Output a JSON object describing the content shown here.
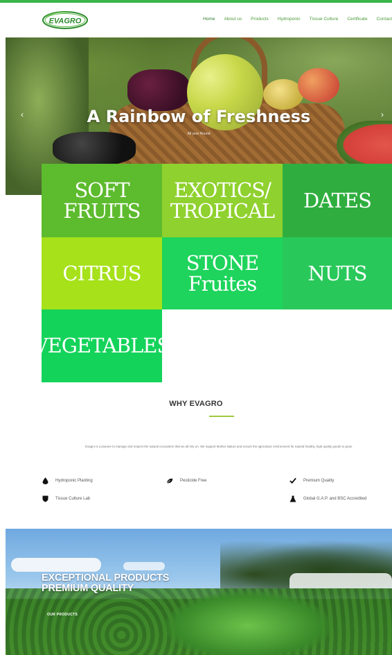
{
  "nav": {
    "items": [
      "Home",
      "About us",
      "Products",
      "Hydroponic",
      "Tissue Culture",
      "Certificate",
      "Contact"
    ],
    "active_index": 0
  },
  "logo": {
    "text": "EVAGRO"
  },
  "hero": {
    "title": "A Rainbow of Freshness",
    "subtitle": "All year Round",
    "prev_glyph": "‹",
    "next_glyph": "›"
  },
  "categories": [
    {
      "label": "SOFT FRUITS",
      "color": "#5dbb2e"
    },
    {
      "label": "EXOTICS/ TROPICAL",
      "color": "#8fd12e"
    },
    {
      "label": "DATES",
      "color": "#2fae3f"
    },
    {
      "label": "CITRUS",
      "color": "#a6e11a"
    },
    {
      "label": "STONE Fruites",
      "color": "#1ed45c"
    },
    {
      "label": "NUTS",
      "color": "#29c85a"
    },
    {
      "label": "VEGETABLES",
      "color": "#14d35a"
    }
  ],
  "why": {
    "title": "WHY EVAGRO",
    "description": "Evagro is a pioneer to manage and respect the natural ecosystem that we all rely on. We support Mother Nature and ensure the agriculture environment for natural healthy, high quality goods to grow.",
    "features": [
      {
        "label": "Hydroponic Planting",
        "icon": "drop-icon"
      },
      {
        "label": "Pesticide Free",
        "icon": "leaf-icon"
      },
      {
        "label": "Premium Quality",
        "icon": "check-icon"
      },
      {
        "label": "Tissue Culture Lab",
        "icon": "shield-icon"
      },
      {
        "label": "Global G.A.P. and BSC Accredited",
        "icon": "flask-icon"
      }
    ]
  },
  "banner": {
    "title_line1": "EXCEPTIONAL PRODUCTS",
    "title_line2": "PREMIUM QUALITY",
    "button": "OUR PRODUCTS"
  },
  "colors": {
    "brand_green": "#39b54a",
    "accent_line": "#9fc93c"
  }
}
